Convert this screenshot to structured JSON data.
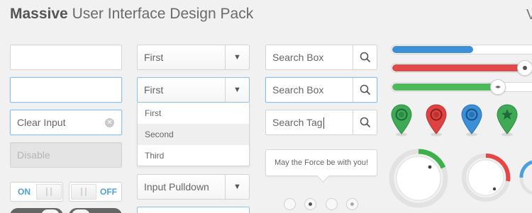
{
  "header": {
    "brand": "Massive",
    "title": "User Interface Design Pack",
    "overflow_letter": "V"
  },
  "inputs": {
    "empty_1": "",
    "focused_empty": "",
    "clear_input_value": "Clear Input",
    "clear_icon": "x-circle-icon",
    "disabled_placeholder": "Disable"
  },
  "toggles": {
    "on_label": "ON",
    "off_label": "OFF"
  },
  "selects": {
    "first_label": "First",
    "open_label": "First",
    "options": [
      "First",
      "Second",
      "Third"
    ],
    "highlighted_option": "Second",
    "pulldown_label": "Input Pulldown"
  },
  "search": {
    "box1_placeholder": "Search Box",
    "box2_placeholder": "Search Box",
    "tag_value": "Search Tag"
  },
  "tooltip": {
    "text": "May the Force be with you!"
  },
  "pagination": {
    "count": 4,
    "active_index": 1
  },
  "sliders": [
    {
      "color": "#3d8fd6",
      "level": 0.58
    },
    {
      "color": "#e24a4a",
      "level": 1.0
    },
    {
      "color": "#4fb85a",
      "level": 0.75
    }
  ],
  "pins": [
    {
      "color": "#3faa55",
      "icon": "circle-icon"
    },
    {
      "color": "#e04242",
      "icon": "circle-icon"
    },
    {
      "color": "#3a8fd8",
      "icon": "circle-icon"
    },
    {
      "color": "#3faa55",
      "icon": "star-icon"
    }
  ],
  "dials": [
    {
      "color": "#3db04b",
      "level": 0.2
    },
    {
      "color": "#e84545",
      "level": 0.35
    },
    {
      "color": "#4a9fe0",
      "level": 0.5
    }
  ],
  "colors": {
    "accent_blue": "#4aa3df",
    "border": "#d4d4d4",
    "background": "#f1f1f1"
  }
}
